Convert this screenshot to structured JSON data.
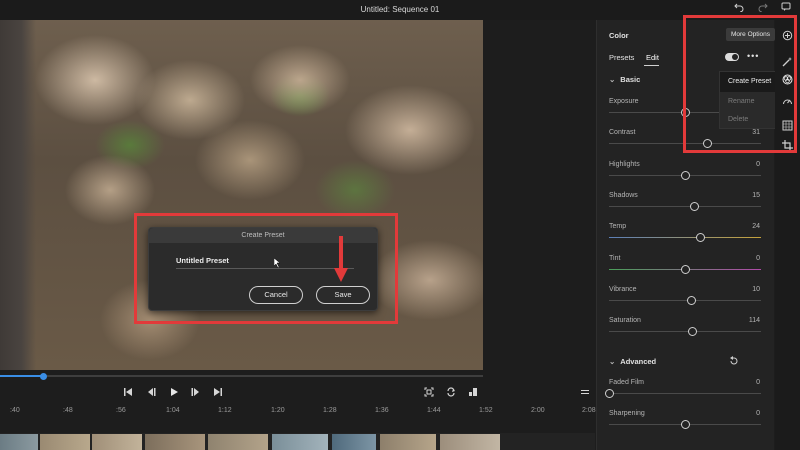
{
  "window": {
    "title": "Untitled: Sequence 01"
  },
  "colors": {
    "accent": "#3a8ee6",
    "highlight": "#e23a3a",
    "panel_bg": "#232323"
  },
  "playback": {
    "progress_fraction": 0.09
  },
  "dialog": {
    "title": "Create Preset",
    "preset_name": "Untitled Preset",
    "cancel_label": "Cancel",
    "save_label": "Save"
  },
  "timecodes": [
    ":40",
    ":48",
    ":56",
    "1:04",
    "1:12",
    "1:20",
    "1:28",
    "1:36",
    "1:44",
    "1:52",
    "2:00",
    "2:08"
  ],
  "panel": {
    "title": "Color",
    "tabs": [
      "Presets",
      "Edit"
    ],
    "active_tab": "Edit",
    "tooltip": "More Options",
    "menu": [
      "Create Preset",
      "Rename",
      "Delete"
    ],
    "sections": {
      "basic": {
        "title": "Basic",
        "sliders": [
          {
            "label": "Exposure",
            "value": "",
            "level": 0.5
          },
          {
            "label": "Contrast",
            "value": "31",
            "level": 0.65
          },
          {
            "label": "Highlights",
            "value": "0",
            "level": 0.5
          },
          {
            "label": "Shadows",
            "value": "15",
            "level": 0.56
          },
          {
            "label": "Temp",
            "value": "24",
            "level": 0.6
          },
          {
            "label": "Tint",
            "value": "0",
            "level": 0.5
          },
          {
            "label": "Vibrance",
            "value": "10",
            "level": 0.54
          },
          {
            "label": "Saturation",
            "value": "114",
            "level": 0.55
          }
        ]
      },
      "advanced": {
        "title": "Advanced",
        "sliders": [
          {
            "label": "Faded Film",
            "value": "0",
            "level": 0.0
          },
          {
            "label": "Sharpening",
            "value": "0",
            "level": 0.5
          }
        ]
      }
    }
  }
}
